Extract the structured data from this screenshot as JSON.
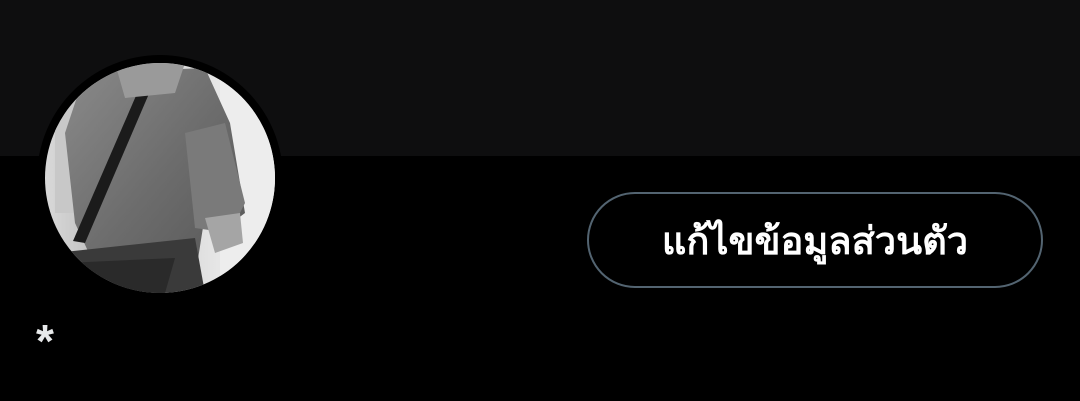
{
  "profile": {
    "display_name": "*",
    "edit_button_label": "แก้ไขข้อมูลส่วนตัว"
  },
  "colors": {
    "background": "#000000",
    "banner": "#0e0e0f",
    "button_border": "#536471",
    "text_primary": "#e7e9ea"
  }
}
